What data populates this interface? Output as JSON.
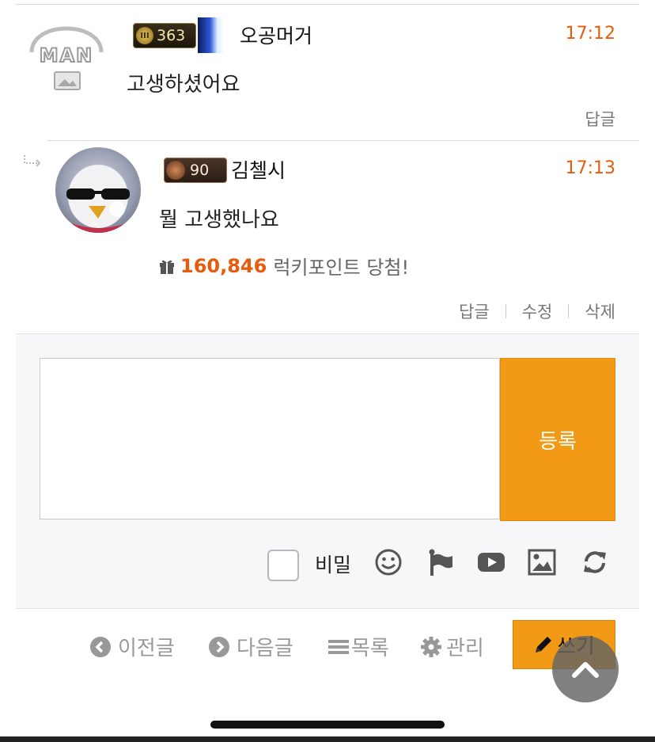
{
  "comments": [
    {
      "level": "363",
      "level_emblem": "III",
      "author": "오공머거",
      "time": "17:12",
      "text": "고생하셨어요",
      "actions": [
        "답글"
      ]
    },
    {
      "level": "90",
      "author": "김첼시",
      "time": "17:13",
      "text": "뭘 고생했나요",
      "lucky_points": "160,846",
      "lucky_text": "럭키포인트 당첨!",
      "actions": [
        "답글",
        "수정",
        "삭제"
      ]
    }
  ],
  "form": {
    "submit_label": "등록",
    "secret_label": "비밀",
    "textarea_value": "",
    "tool_icons": [
      "smile-icon",
      "flag-icon",
      "youtube-icon",
      "image-icon",
      "refresh-icon"
    ]
  },
  "nav": {
    "prev": "이전글",
    "next": "다음글",
    "list": "목록",
    "manage": "관리",
    "write": "쓰기"
  },
  "colors": {
    "accent": "#f29a16",
    "time": "#e85a0c",
    "points": "#e85a0c"
  }
}
